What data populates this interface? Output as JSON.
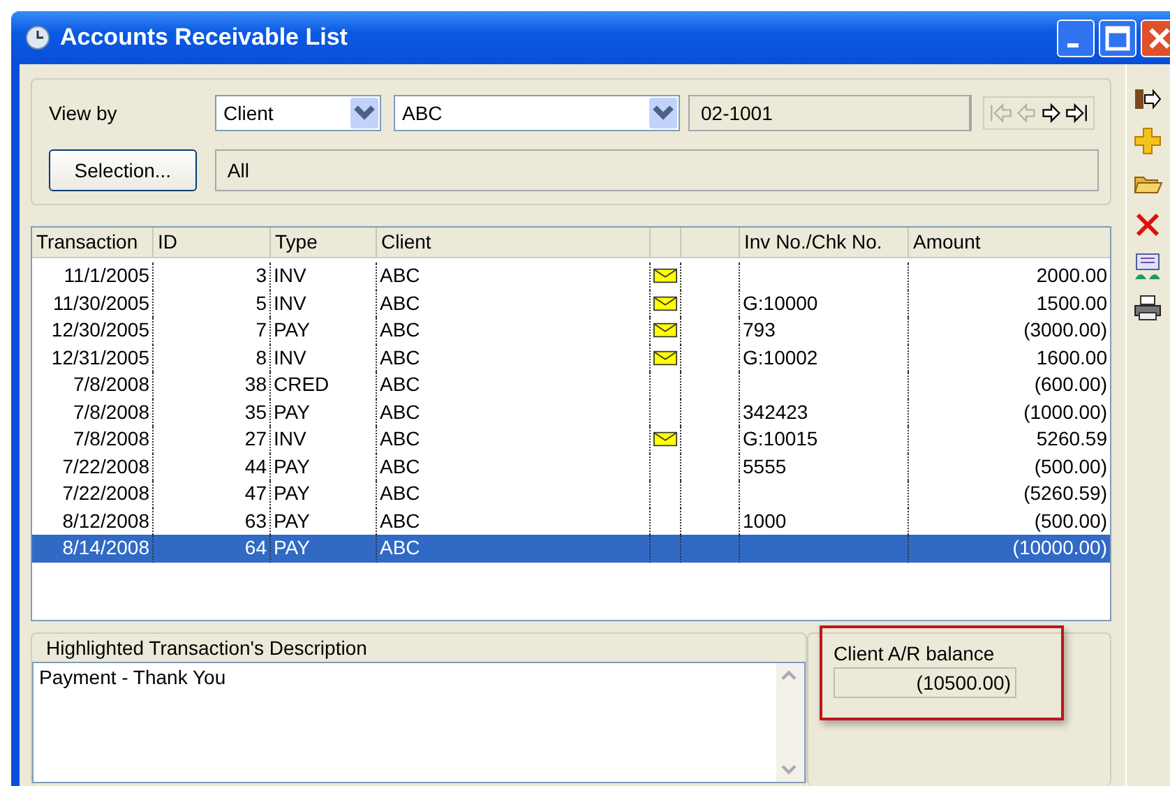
{
  "window": {
    "title": "Accounts Receivable List"
  },
  "filter": {
    "view_by_label": "View by",
    "view_by": "Client",
    "client": "ABC",
    "client_code": "02-1001",
    "selection_button": "Selection...",
    "selection": "All"
  },
  "nav_buttons": [
    {
      "kind": "first",
      "disabled": true
    },
    {
      "kind": "prev",
      "disabled": true
    },
    {
      "kind": "next",
      "disabled": false
    },
    {
      "kind": "last",
      "disabled": false
    }
  ],
  "table": {
    "columns": [
      "Transaction",
      "ID",
      "Type",
      "Client",
      "",
      "",
      "Inv No./Chk No.",
      "Amount"
    ],
    "rows": [
      {
        "date": "11/1/2005",
        "id": "3",
        "type": "INV",
        "client": "ABC",
        "has_note": true,
        "ref": "",
        "amount": "2000.00",
        "selected": false
      },
      {
        "date": "11/30/2005",
        "id": "5",
        "type": "INV",
        "client": "ABC",
        "has_note": true,
        "ref": "G:10000",
        "amount": "1500.00",
        "selected": false
      },
      {
        "date": "12/30/2005",
        "id": "7",
        "type": "PAY",
        "client": "ABC",
        "has_note": true,
        "ref": "793",
        "amount": "(3000.00)",
        "selected": false
      },
      {
        "date": "12/31/2005",
        "id": "8",
        "type": "INV",
        "client": "ABC",
        "has_note": true,
        "ref": "G:10002",
        "amount": "1600.00",
        "selected": false
      },
      {
        "date": "7/8/2008",
        "id": "38",
        "type": "CRED",
        "client": "ABC",
        "has_note": false,
        "ref": "",
        "amount": "(600.00)",
        "selected": false
      },
      {
        "date": "7/8/2008",
        "id": "35",
        "type": "PAY",
        "client": "ABC",
        "has_note": false,
        "ref": "342423",
        "amount": "(1000.00)",
        "selected": false
      },
      {
        "date": "7/8/2008",
        "id": "27",
        "type": "INV",
        "client": "ABC",
        "has_note": true,
        "ref": "G:10015",
        "amount": "5260.59",
        "selected": false
      },
      {
        "date": "7/22/2008",
        "id": "44",
        "type": "PAY",
        "client": "ABC",
        "has_note": false,
        "ref": "5555",
        "amount": "(500.00)",
        "selected": false
      },
      {
        "date": "7/22/2008",
        "id": "47",
        "type": "PAY",
        "client": "ABC",
        "has_note": false,
        "ref": "",
        "amount": "(5260.59)",
        "selected": false
      },
      {
        "date": "8/12/2008",
        "id": "63",
        "type": "PAY",
        "client": "ABC",
        "has_note": false,
        "ref": "1000",
        "amount": "(500.00)",
        "selected": false
      },
      {
        "date": "8/14/2008",
        "id": "64",
        "type": "PAY",
        "client": "ABC",
        "has_note": false,
        "ref": "",
        "amount": "(10000.00)",
        "selected": true
      }
    ]
  },
  "description": {
    "title": "Highlighted Transaction's Description",
    "text": "Payment - Thank You"
  },
  "balance": {
    "label": "Client A/R balance",
    "value": "(10500.00)"
  }
}
